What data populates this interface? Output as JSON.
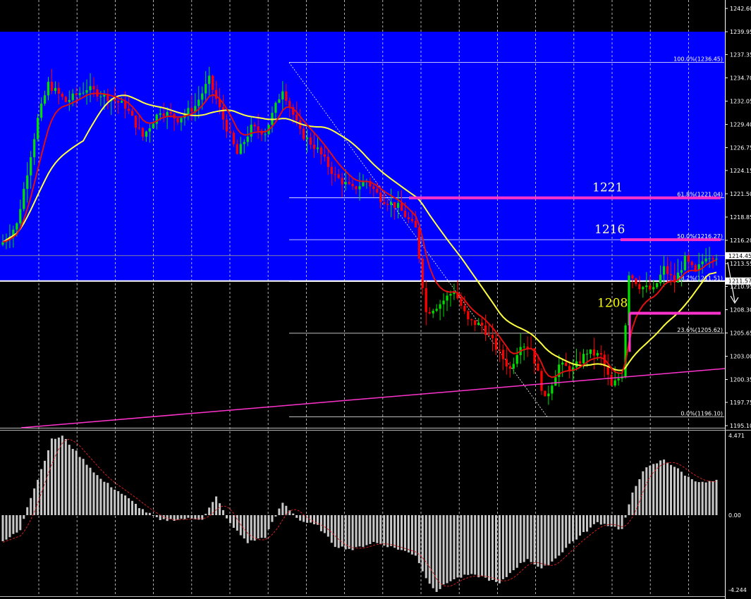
{
  "colors": {
    "background": "#000000",
    "blue_zone": "#0000ff",
    "bull_candle": "#00e000",
    "bear_candle": "#ff0000",
    "ma_fast": "#e01010",
    "ma_slow": "#ffff40",
    "level_magenta": "#ff33cc",
    "trendline": "#ff33cc",
    "fib_line": "#ffffff",
    "hist": "#c8c8c8",
    "signal": "#d02020",
    "grid": "#ffffff"
  },
  "chart_data": [
    {
      "type": "candlestick",
      "panel": "price",
      "y_axis_ticks": [
        "1242.60",
        "1239.95",
        "1237.35",
        "1234.70",
        "1232.05",
        "1229.40",
        "1226.75",
        "1224.15",
        "1221.50",
        "1218.85",
        "1216.20",
        "1213.55",
        "1210.95",
        "1208.30",
        "1205.65",
        "1203.00",
        "1200.35",
        "1197.75",
        "1195.10"
      ],
      "ylim": [
        1195.1,
        1242.6
      ],
      "price_label_current": "1214.45",
      "price_label_white_line": "1211.57",
      "white_line_value": 1211.57,
      "current_line_value": 1214.45,
      "blue_zone": {
        "top": 1239.95,
        "bottom": 1211.57
      },
      "anchors": [
        {
          "i": 0,
          "p": 1216.0
        },
        {
          "i": 4,
          "p": 1218.0
        },
        {
          "i": 7,
          "p": 1224.0
        },
        {
          "i": 10,
          "p": 1230.0
        },
        {
          "i": 13,
          "p": 1234.0
        },
        {
          "i": 18,
          "p": 1232.0
        },
        {
          "i": 24,
          "p": 1233.5
        },
        {
          "i": 30,
          "p": 1232.5
        },
        {
          "i": 35,
          "p": 1231.5
        },
        {
          "i": 40,
          "p": 1228.0
        },
        {
          "i": 45,
          "p": 1231.0
        },
        {
          "i": 50,
          "p": 1230.0
        },
        {
          "i": 55,
          "p": 1231.5
        },
        {
          "i": 59,
          "p": 1234.5
        },
        {
          "i": 63,
          "p": 1230.0
        },
        {
          "i": 67,
          "p": 1226.0
        },
        {
          "i": 71,
          "p": 1229.0
        },
        {
          "i": 75,
          "p": 1228.5
        },
        {
          "i": 80,
          "p": 1233.5
        },
        {
          "i": 85,
          "p": 1228.5
        },
        {
          "i": 90,
          "p": 1226.5
        },
        {
          "i": 95,
          "p": 1223.5
        },
        {
          "i": 100,
          "p": 1222.0
        },
        {
          "i": 104,
          "p": 1223.0
        },
        {
          "i": 108,
          "p": 1221.0
        },
        {
          "i": 113,
          "p": 1220.0
        },
        {
          "i": 118,
          "p": 1217.5
        },
        {
          "i": 121,
          "p": 1208.0
        },
        {
          "i": 125,
          "p": 1209.0
        },
        {
          "i": 129,
          "p": 1210.5
        },
        {
          "i": 133,
          "p": 1207.0
        },
        {
          "i": 137,
          "p": 1206.5
        },
        {
          "i": 141,
          "p": 1204.0
        },
        {
          "i": 145,
          "p": 1201.5
        },
        {
          "i": 148,
          "p": 1204.5
        },
        {
          "i": 151,
          "p": 1204.0
        },
        {
          "i": 155,
          "p": 1198.0
        },
        {
          "i": 159,
          "p": 1202.0
        },
        {
          "i": 163,
          "p": 1201.5
        },
        {
          "i": 167,
          "p": 1203.5
        },
        {
          "i": 171,
          "p": 1203.0
        },
        {
          "i": 174,
          "p": 1199.5
        },
        {
          "i": 177,
          "p": 1201.0
        },
        {
          "i": 179,
          "p": 1212.5
        },
        {
          "i": 182,
          "p": 1211.0
        },
        {
          "i": 186,
          "p": 1210.5
        },
        {
          "i": 189,
          "p": 1213.0
        },
        {
          "i": 192,
          "p": 1211.5
        },
        {
          "i": 195,
          "p": 1214.0
        },
        {
          "i": 198,
          "p": 1212.5
        },
        {
          "i": 201,
          "p": 1214.5
        },
        {
          "i": 204,
          "p": 1214.45
        }
      ],
      "bar_count": 205,
      "fibonacci": {
        "high": 1236.45,
        "low": 1196.1,
        "levels": [
          {
            "label": "100.0%(1236.45)",
            "value": 1236.45
          },
          {
            "label": "61.8%(1221.04)",
            "value": 1221.04
          },
          {
            "label": "50.0%(1216.27)",
            "value": 1216.27
          },
          {
            "label": "38.2%(1211.51)",
            "value": 1211.51
          },
          {
            "label": "23.6%(1205.62)",
            "value": 1205.62
          },
          {
            "label": "0.0%(1196.10)",
            "value": 1196.1
          }
        ]
      },
      "annotations": [
        {
          "text": "1221",
          "value": 1221.04,
          "color": "#ffffcc"
        },
        {
          "text": "1216",
          "value": 1216.27,
          "color": "#ffffcc"
        },
        {
          "text": "1208",
          "value": 1207.9,
          "color": "#ffff00"
        }
      ]
    },
    {
      "type": "bar",
      "panel": "oscillator",
      "y_axis_ticks": [
        "4.471",
        "0.00",
        "-4.244"
      ],
      "ylim": [
        -4.244,
        4.471
      ],
      "anchors": [
        {
          "i": 0,
          "v": -1.5
        },
        {
          "i": 5,
          "v": -0.8
        },
        {
          "i": 7,
          "v": 0.5
        },
        {
          "i": 10,
          "v": 2.0
        },
        {
          "i": 14,
          "v": 4.2
        },
        {
          "i": 17,
          "v": 4.4
        },
        {
          "i": 22,
          "v": 3.3
        },
        {
          "i": 28,
          "v": 2.0
        },
        {
          "i": 34,
          "v": 1.2
        },
        {
          "i": 40,
          "v": 0.3
        },
        {
          "i": 45,
          "v": -0.3
        },
        {
          "i": 52,
          "v": -0.2
        },
        {
          "i": 57,
          "v": -0.2
        },
        {
          "i": 61,
          "v": 1.0
        },
        {
          "i": 65,
          "v": -0.5
        },
        {
          "i": 70,
          "v": -1.5
        },
        {
          "i": 75,
          "v": -1.2
        },
        {
          "i": 80,
          "v": 0.7
        },
        {
          "i": 85,
          "v": -0.3
        },
        {
          "i": 90,
          "v": -0.6
        },
        {
          "i": 95,
          "v": -1.7
        },
        {
          "i": 100,
          "v": -1.9
        },
        {
          "i": 106,
          "v": -1.5
        },
        {
          "i": 112,
          "v": -1.8
        },
        {
          "i": 118,
          "v": -2.2
        },
        {
          "i": 121,
          "v": -3.5
        },
        {
          "i": 124,
          "v": -4.2
        },
        {
          "i": 128,
          "v": -3.6
        },
        {
          "i": 133,
          "v": -3.3
        },
        {
          "i": 137,
          "v": -3.4
        },
        {
          "i": 142,
          "v": -3.8
        },
        {
          "i": 146,
          "v": -3.0
        },
        {
          "i": 150,
          "v": -2.4
        },
        {
          "i": 154,
          "v": -3.0
        },
        {
          "i": 158,
          "v": -2.4
        },
        {
          "i": 162,
          "v": -1.6
        },
        {
          "i": 166,
          "v": -1.0
        },
        {
          "i": 170,
          "v": -0.4
        },
        {
          "i": 174,
          "v": -0.6
        },
        {
          "i": 177,
          "v": -0.8
        },
        {
          "i": 180,
          "v": 1.2
        },
        {
          "i": 183,
          "v": 2.5
        },
        {
          "i": 186,
          "v": 2.8
        },
        {
          "i": 189,
          "v": 3.1
        },
        {
          "i": 192,
          "v": 2.7
        },
        {
          "i": 196,
          "v": 2.1
        },
        {
          "i": 200,
          "v": 1.8
        },
        {
          "i": 204,
          "v": 1.9
        }
      ],
      "bar_count": 205
    }
  ]
}
